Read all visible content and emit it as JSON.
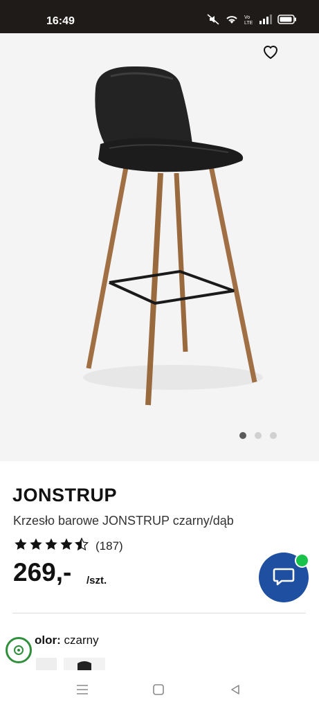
{
  "status_bar": {
    "time": "16:49",
    "icons": [
      "mute-icon",
      "wifi-icon",
      "volte-icon",
      "signal-icon",
      "battery-icon"
    ]
  },
  "gallery": {
    "image_alt": "bar-stool-image",
    "dots": 3,
    "active_dot": 1
  },
  "product": {
    "brand": "JONSTRUP",
    "subtitle": "Krzesło barowe JONSTRUP czarny/dąb",
    "rating": 4.5,
    "rating_count": "(187)",
    "price": "269,-",
    "unit": "/szt."
  },
  "color_section": {
    "label_prefix": "olor:",
    "value": "czarny"
  },
  "colors": {
    "accent_blue": "#1f4fa0",
    "online_green": "#19c24a"
  }
}
